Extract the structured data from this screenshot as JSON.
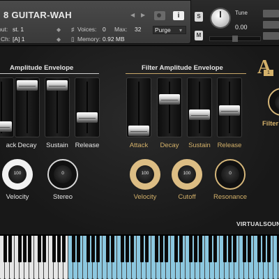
{
  "header": {
    "title": "8 GUITAR-WAH",
    "output_label": "out:",
    "output_value": "st. 1",
    "midi_label": "Ch:",
    "midi_value": "[A] 1",
    "voices_label": "Voices:",
    "voices_value": "0",
    "max_label": "Max:",
    "max_value": "32",
    "memory_label": "Memory:",
    "memory_value": "0.92 MB",
    "purge_label": "Purge",
    "solo_label": "S",
    "mute_label": "M",
    "tune_label": "Tune",
    "tune_value": "0.00",
    "info_label": "i"
  },
  "amp_env": {
    "title": "Amplitude Envelope",
    "sliders": [
      {
        "label": "ack",
        "level": 0.1
      },
      {
        "label": "Decay",
        "level": 1.0
      },
      {
        "label": "Sustain",
        "level": 1.0
      },
      {
        "label": "Release",
        "level": 0.3
      }
    ],
    "knobs": [
      {
        "label": "Velocity",
        "value": "100"
      },
      {
        "label": "Stereo",
        "value": "0"
      }
    ]
  },
  "filter_env": {
    "title": "Filter Amplitude Envelope",
    "sliders": [
      {
        "label": "Attack",
        "level": 0.0
      },
      {
        "label": "Decay",
        "level": 0.7
      },
      {
        "label": "Sustain",
        "level": 0.35
      },
      {
        "label": "Release",
        "level": 0.45
      }
    ],
    "knobs": [
      {
        "label": "Velocity",
        "value": "100"
      },
      {
        "label": "Cutoff",
        "value": "100"
      },
      {
        "label": "Resonance",
        "value": "0"
      }
    ]
  },
  "right": {
    "logo_letter": "A",
    "logo_badge": "1",
    "knob_label": "Filter"
  },
  "brand": "VIRTUALSOUND",
  "colors": {
    "gold": "#d4b16a",
    "white_label": "#e6e6e6",
    "key_blue": "#8cc8e0",
    "key_white": "#e6e6e6"
  },
  "keyboard": {
    "highlight_start_fraction": 0.25
  }
}
